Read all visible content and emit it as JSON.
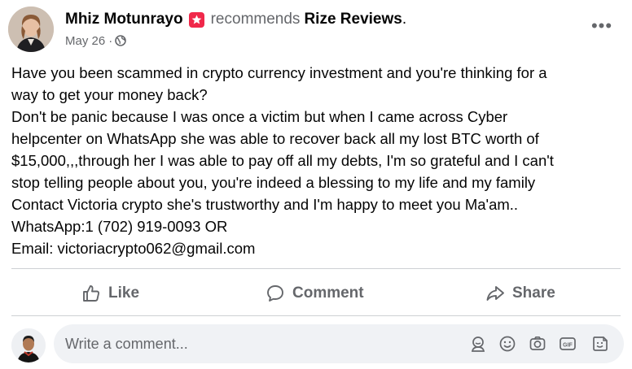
{
  "post": {
    "author": "Mhiz Motunrayo",
    "recommends_text": "recommends",
    "page_name": "Rize Reviews",
    "page_suffix": ".",
    "date": "May 26",
    "date_sep": "·",
    "audience_icon": "globe-icon",
    "more_label": "•••",
    "text_lines": [
      "Have you been scammed in crypto currency investment and you're thinking for a",
      "way to get your money back?",
      "Don't be panic because I was once a victim but when I came across Cyber",
      "helpcenter on WhatsApp she was able to recover back all my lost BTC worth of",
      "$15,000,,,through her I was able to pay off all my debts, I'm so grateful and I can't",
      "stop telling people about you, you're indeed a blessing to my life and my family",
      "Contact Victoria crypto she's trustworthy and I'm happy to meet you Ma'am..",
      "WhatsApp:1 (702) 919-0093 OR",
      "Email: victoriacrypto062@gmail.com"
    ]
  },
  "actions": {
    "like": "Like",
    "comment": "Comment",
    "share": "Share"
  },
  "comment_box": {
    "placeholder": "Write a comment...",
    "icons": [
      "avatar-sticker-icon",
      "emoji-icon",
      "camera-icon",
      "gif-icon",
      "sticker-icon"
    ]
  },
  "colors": {
    "text": "#050505",
    "secondary": "#65676b",
    "recommend_badge": "#f0284a",
    "comment_bg": "#f0f2f5",
    "divider": "#ced0d4"
  }
}
